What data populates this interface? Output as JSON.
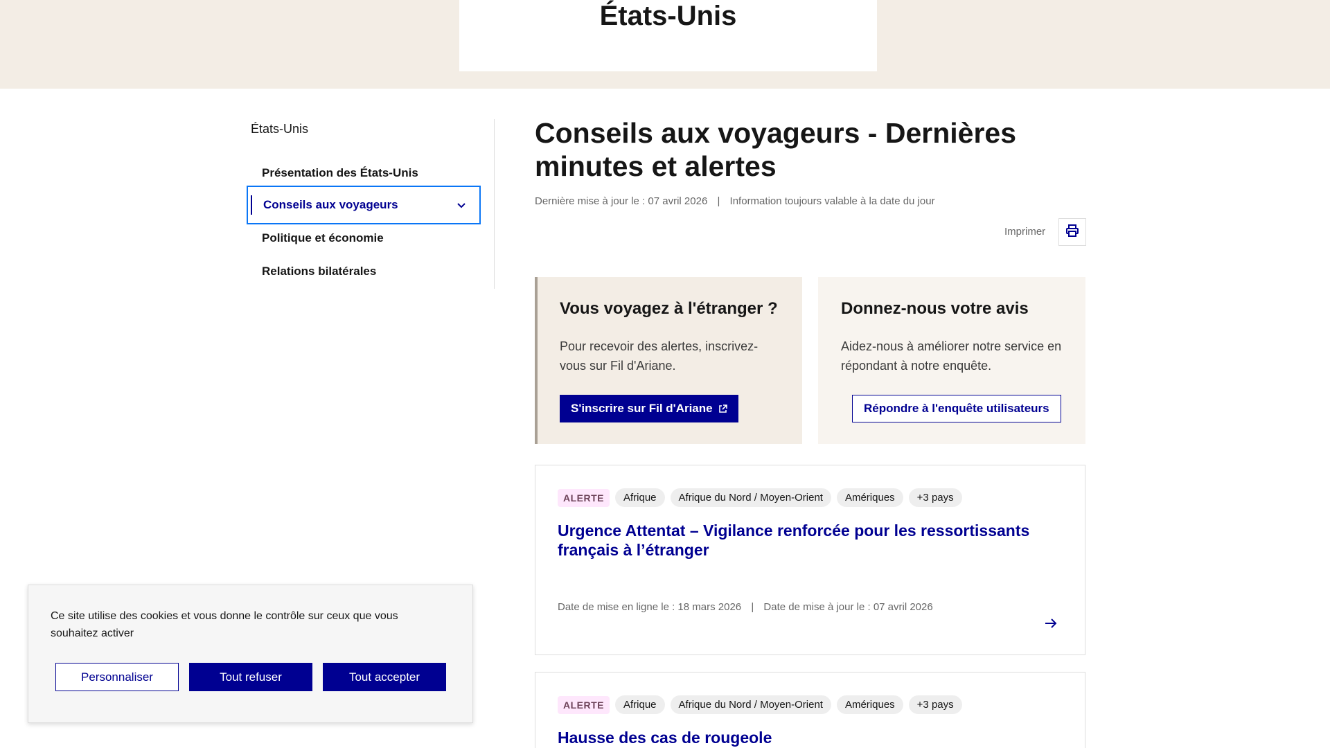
{
  "hero": {
    "title": "États-Unis"
  },
  "sidenav": {
    "heading": "États-Unis",
    "items": [
      {
        "label": "Présentation des États-Unis"
      },
      {
        "label": "Conseils aux voyageurs"
      },
      {
        "label": "Politique et économie"
      },
      {
        "label": "Relations bilatérales"
      }
    ]
  },
  "main": {
    "title": "Conseils aux voyageurs - Dernières minutes et alertes",
    "last_update": "Dernière mise à jour le : 07 avril 2026",
    "meta_separator": "|",
    "validity": "Information toujours valable à la date du jour",
    "print_label": "Imprimer"
  },
  "cards": {
    "travel": {
      "heading": "Vous voyagez à l'étranger ?",
      "text": "Pour recevoir des alertes, inscrivez-vous sur Fil d'Ariane.",
      "button": "S'inscrire sur Fil d'Ariane"
    },
    "avis": {
      "heading": "Donnez-nous votre avis",
      "text": "Aidez-nous à améliorer notre service en répondant à notre enquête.",
      "button": "Répondre à l'enquête utilisateurs"
    }
  },
  "articles": [
    {
      "badge": "ALERTE",
      "tags": [
        "Afrique",
        "Afrique du Nord / Moyen-Orient",
        "Amériques",
        "+3 pays"
      ],
      "title": "Urgence Attentat – Vigilance renforcée pour les ressortissants français à l’étranger",
      "published": "Date de mise en ligne le : 18 mars 2026",
      "updated": "Date de mise à jour le : 07 avril 2026",
      "separator": "|"
    },
    {
      "badge": "ALERTE",
      "tags": [
        "Afrique",
        "Afrique du Nord / Moyen-Orient",
        "Amériques",
        "+3 pays"
      ],
      "title": "Hausse des cas de rougeole"
    }
  ],
  "cookie": {
    "text": "Ce site utilise des cookies et vous donne le contrôle sur ceux que vous souhaitez activer",
    "customize": "Personnaliser",
    "refuse": "Tout refuser",
    "accept": "Tout accepter"
  },
  "colors": {
    "primary": "#000091",
    "hero_bg": "#f3ede5",
    "focus": "#0a76f6",
    "alert_tag_bg": "#fee7fc"
  },
  "icons": {
    "print": "printer-icon",
    "external": "external-link-icon",
    "chevron": "chevron-down-icon",
    "arrow": "arrow-right-icon"
  }
}
